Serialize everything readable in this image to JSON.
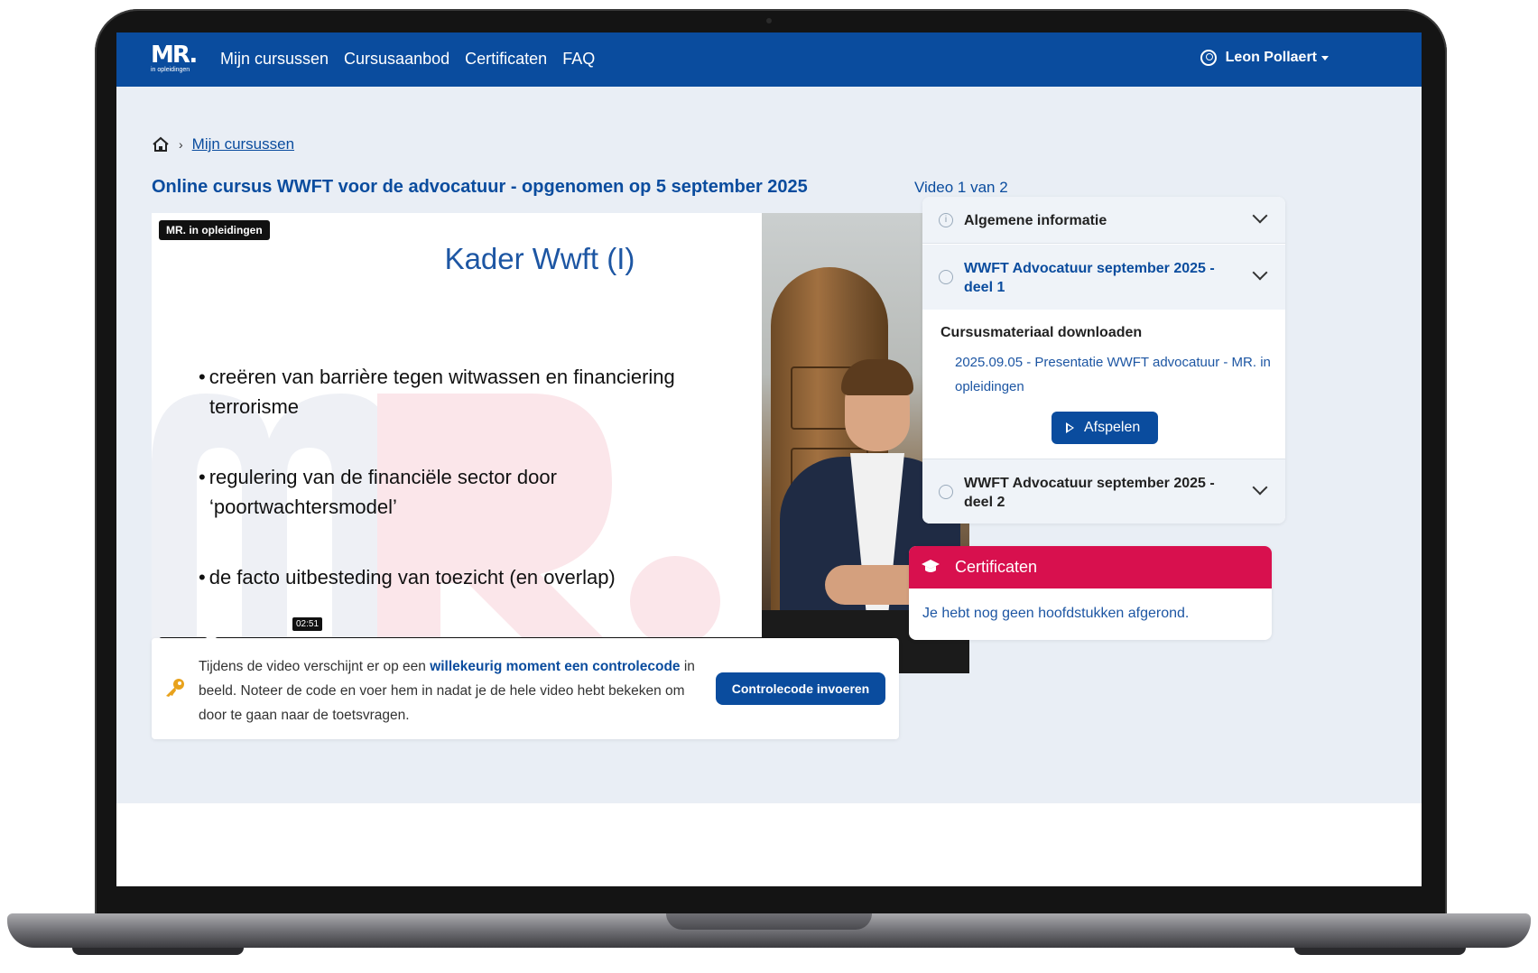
{
  "app": {
    "logo_text": "MR.",
    "logo_subtext": "in opleidingen"
  },
  "nav": {
    "links": [
      "Mijn cursussen",
      "Cursusaanbod",
      "Certificaten",
      "FAQ"
    ],
    "user_name": "Leon Pollaert"
  },
  "breadcrumb": {
    "link": "Mijn cursussen"
  },
  "page": {
    "title": "Online cursus WWFT voor de advocatuur - opgenomen op 5 september 2025",
    "video_counter": "Video 1 van 2"
  },
  "video": {
    "badge": "MR. in opleidingen",
    "slide_title": "Kader Wwft (I)",
    "bullets": [
      "creëren van barrière tegen witwassen en financiering terrorisme",
      "regulering van de financiële sector door ‘poortwachtersmodel’",
      "de facto uitbesteding van toezicht (en overlap)"
    ],
    "current_time": "02:51",
    "progress_fraction": 0.05
  },
  "notice": {
    "text_before": "Tijdens de video verschijnt er op een ",
    "text_bold": "willekeurig moment een controlecode",
    "text_after": " in beeld. Noteer de code en voer hem in nadat je de hele video hebt bekeken om door te gaan naar de toetsvragen.",
    "button": "Controlecode invoeren"
  },
  "sidebar": {
    "sections": [
      {
        "title": "Algemene informatie"
      },
      {
        "title": "WWFT Advocatuur september 2025 - deel 1"
      },
      {
        "title": "WWFT Advocatuur september 2025 - deel 2"
      }
    ],
    "material_heading": "Cursusmateriaal downloaden",
    "material_link": "2025.09.05 - Presentatie WWFT advocatuur - MR. in opleidingen",
    "play_button": "Afspelen"
  },
  "certificates": {
    "title": "Certificaten",
    "empty_text": "Je hebt nog geen hoofdstukken afgerond."
  },
  "colors": {
    "brand_blue": "#0a4c9e",
    "accent_red": "#d8104e",
    "page_bg": "#e9eef5"
  }
}
